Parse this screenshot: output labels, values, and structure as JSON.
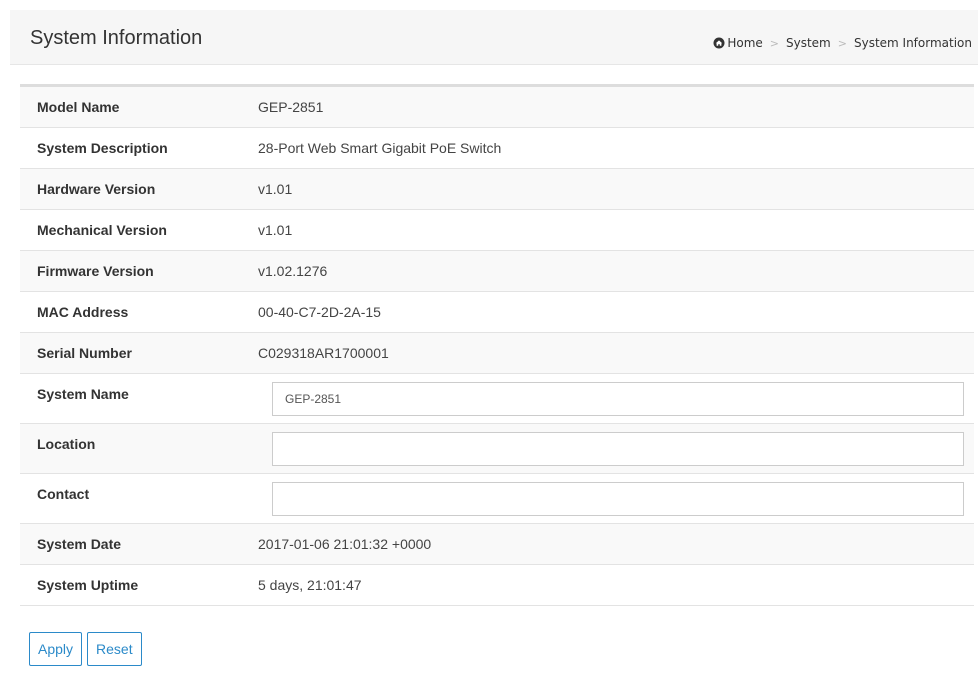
{
  "header": {
    "title": "System Information",
    "breadcrumb": [
      "Home",
      "System",
      "System Information"
    ],
    "breadcrumb_separator": ">"
  },
  "rows": [
    {
      "label": "Model Name",
      "value": "GEP-2851"
    },
    {
      "label": "System Description",
      "value": "28-Port Web Smart Gigabit PoE Switch"
    },
    {
      "label": "Hardware Version",
      "value": "v1.01"
    },
    {
      "label": "Mechanical Version",
      "value": "v1.01"
    },
    {
      "label": "Firmware Version",
      "value": "v1.02.1276"
    },
    {
      "label": "MAC Address",
      "value": "00-40-C7-2D-2A-15"
    },
    {
      "label": "Serial Number",
      "value": "C029318AR1700001"
    },
    {
      "label": "System Name",
      "value": "GEP-2851"
    },
    {
      "label": "Location",
      "value": ""
    },
    {
      "label": "Contact",
      "value": ""
    },
    {
      "label": "System Date",
      "value": "2017-01-06 21:01:32 +0000"
    },
    {
      "label": "System Uptime",
      "value": "5 days, 21:01:47"
    }
  ],
  "buttons": {
    "apply_label": "Apply",
    "reset_label": "Reset"
  },
  "colors": {
    "accent": "#2b8ac9",
    "header_bg": "#f6f6f6",
    "row_alt_bg": "#f9f9f9"
  },
  "icons": {
    "home": "home-icon"
  }
}
